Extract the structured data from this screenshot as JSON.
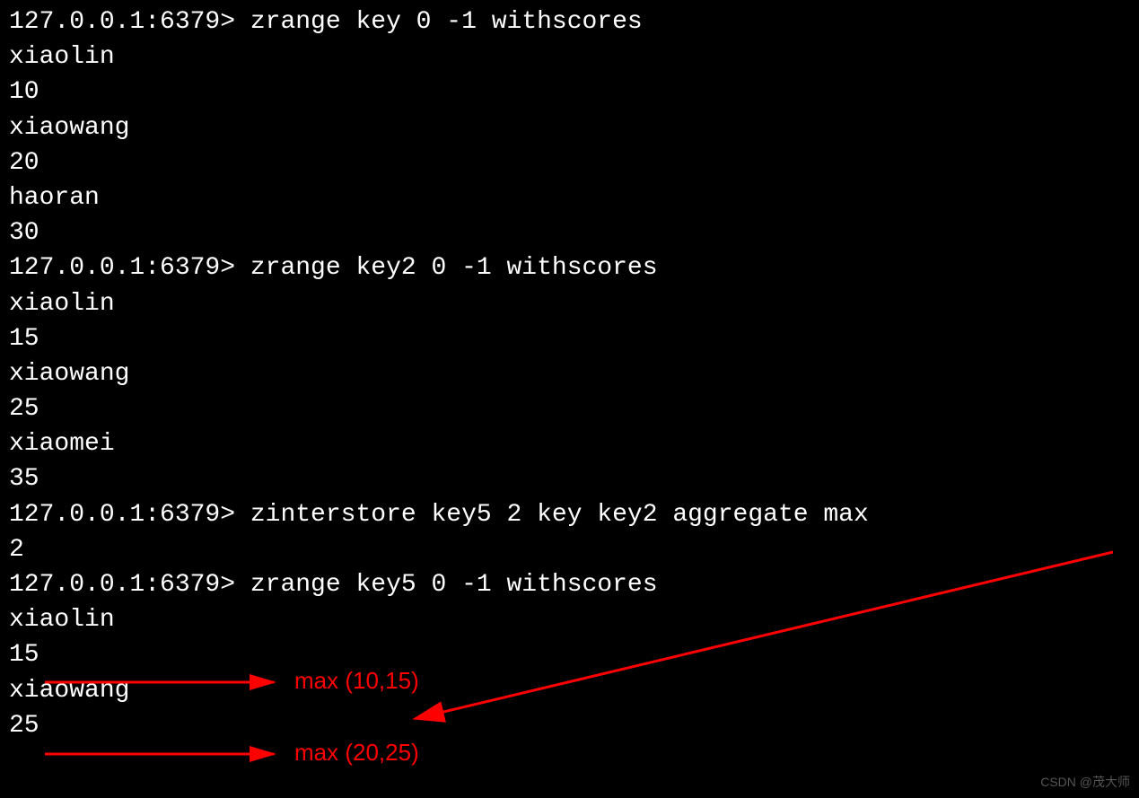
{
  "terminal": {
    "prompt": "127.0.0.1:6379> ",
    "commands": [
      {
        "cmd": "zrange key 0 -1 withscores",
        "output": [
          "xiaolin",
          "10",
          "xiaowang",
          "20",
          "haoran",
          "30"
        ]
      },
      {
        "cmd": "zrange key2 0 -1 withscores",
        "output": [
          "xiaolin",
          "15",
          "xiaowang",
          "25",
          "xiaomei",
          "35"
        ]
      },
      {
        "cmd": "zinterstore key5 2 key key2 aggregate max",
        "output": [
          "2"
        ]
      },
      {
        "cmd": "zrange key5 0 -1 withscores",
        "output": [
          "xiaolin",
          "15",
          "xiaowang",
          "25"
        ]
      }
    ]
  },
  "annotations": {
    "label1": "max (10,15)",
    "label2": "max (20,25)"
  },
  "watermark": "CSDN @茂大师"
}
